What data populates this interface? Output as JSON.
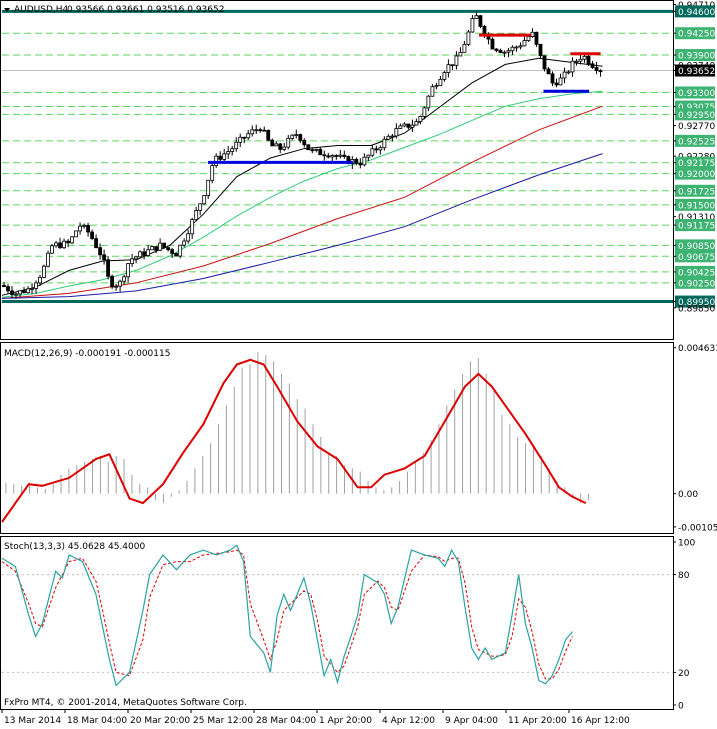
{
  "header": {
    "symbol": "AUDUSD,H4",
    "ohlc": "0.93566 0.93661 0.93516 0.93652"
  },
  "footer": {
    "copyright": "FxPro MT4, © 2001-2014, MetaQuotes Software Corp."
  },
  "colors": {
    "candles": "#000000",
    "level_major": "#00695c",
    "level_minor": "#5cd65c",
    "ma_fast": "#000000",
    "ma_medium": "#32cd7a",
    "ma_slow": "#cc1111",
    "ma_long": "#1a1aa8",
    "support": "#0000dd",
    "resistance": "#dd0000",
    "macd_signal": "#dd0000",
    "macd_hist": "#a0a0a0",
    "stoch_main": "#2aa3a3",
    "stoch_signal": "#dd0000",
    "price_tag_bg": "#000000",
    "level_tag_bg": "#3cb371",
    "major_tag_bg": "#00695c"
  },
  "chart_data": [
    {
      "type": "candlestick",
      "panel": "price",
      "ylim": [
        0.8935,
        0.9475
      ],
      "x_tick_labels": [
        "13 Mar 2014",
        "18 Mar 04:00",
        "20 Mar 20:00",
        "25 Mar 12:00",
        "28 Mar 04:00",
        "1 Apr 20:00",
        "4 Apr 12:00",
        "9 Apr 04:00",
        "11 Apr 20:00",
        "16 Apr 12:00"
      ],
      "y_tick_labels": [
        "0.94710",
        "0.94600",
        "0.94250",
        "0.93900",
        "0.93740",
        "0.93652",
        "0.93300",
        "0.93075",
        "0.92950",
        "0.92770",
        "0.92525",
        "0.92280",
        "0.92175",
        "0.92000",
        "0.91725",
        "0.91500",
        "0.91310",
        "0.91175",
        "0.90850",
        "0.90675",
        "0.90425",
        "0.90250",
        "0.89950",
        "0.89850"
      ],
      "current_price": 0.93652,
      "major_levels": [
        0.946,
        0.8995
      ],
      "minor_levels": [
        0.9425,
        0.939,
        0.933,
        0.93075,
        0.9295,
        0.92525,
        0.92175,
        0.92,
        0.91725,
        0.915,
        0.91175,
        0.9085,
        0.90675,
        0.90425,
        0.9025
      ],
      "support_lines": [
        {
          "x_from": 0.307,
          "x_to": 0.523,
          "price": 0.9218
        },
        {
          "x_from": 0.807,
          "x_to": 0.875,
          "price": 0.9332
        }
      ],
      "resistance_lines": [
        {
          "x_from": 0.711,
          "x_to": 0.788,
          "price": 0.9422
        },
        {
          "x_from": 0.847,
          "x_to": 0.892,
          "price": 0.9392
        }
      ],
      "price_path": [
        [
          0.0,
          0.9021
        ],
        [
          0.02,
          0.9008
        ],
        [
          0.04,
          0.9015
        ],
        [
          0.06,
          0.9042
        ],
        [
          0.075,
          0.9085
        ],
        [
          0.1,
          0.9088
        ],
        [
          0.115,
          0.9118
        ],
        [
          0.13,
          0.9105
        ],
        [
          0.15,
          0.9065
        ],
        [
          0.16,
          0.9025
        ],
        [
          0.175,
          0.9022
        ],
        [
          0.19,
          0.9062
        ],
        [
          0.21,
          0.9072
        ],
        [
          0.235,
          0.9085
        ],
        [
          0.26,
          0.9072
        ],
        [
          0.28,
          0.9115
        ],
        [
          0.3,
          0.9165
        ],
        [
          0.315,
          0.922
        ],
        [
          0.34,
          0.9238
        ],
        [
          0.365,
          0.9262
        ],
        [
          0.385,
          0.9275
        ],
        [
          0.4,
          0.9245
        ],
        [
          0.415,
          0.924
        ],
        [
          0.44,
          0.9265
        ],
        [
          0.46,
          0.9235
        ],
        [
          0.49,
          0.9232
        ],
        [
          0.51,
          0.9222
        ],
        [
          0.535,
          0.9218
        ],
        [
          0.56,
          0.9242
        ],
        [
          0.585,
          0.9268
        ],
        [
          0.6,
          0.9275
        ],
        [
          0.62,
          0.9283
        ],
        [
          0.64,
          0.9335
        ],
        [
          0.66,
          0.9368
        ],
        [
          0.68,
          0.9385
        ],
        [
          0.695,
          0.9425
        ],
        [
          0.705,
          0.9455
        ],
        [
          0.715,
          0.9435
        ],
        [
          0.73,
          0.9405
        ],
        [
          0.75,
          0.9395
        ],
        [
          0.77,
          0.9405
        ],
        [
          0.79,
          0.9425
        ],
        [
          0.805,
          0.9378
        ],
        [
          0.82,
          0.9345
        ],
        [
          0.835,
          0.9352
        ],
        [
          0.85,
          0.9375
        ],
        [
          0.865,
          0.939
        ],
        [
          0.88,
          0.9375
        ],
        [
          0.895,
          0.9365
        ]
      ],
      "moving_averages": [
        {
          "name": "ma_fast",
          "points": [
            [
              0.0,
              0.9005
            ],
            [
              0.05,
              0.9018
            ],
            [
              0.1,
              0.9045
            ],
            [
              0.15,
              0.906
            ],
            [
              0.2,
              0.9062
            ],
            [
              0.25,
              0.9085
            ],
            [
              0.3,
              0.9135
            ],
            [
              0.35,
              0.9195
            ],
            [
              0.4,
              0.9225
            ],
            [
              0.45,
              0.924
            ],
            [
              0.5,
              0.9245
            ],
            [
              0.55,
              0.9245
            ],
            [
              0.6,
              0.9265
            ],
            [
              0.65,
              0.9305
            ],
            [
              0.7,
              0.9345
            ],
            [
              0.75,
              0.9375
            ],
            [
              0.8,
              0.9385
            ],
            [
              0.85,
              0.9378
            ],
            [
              0.895,
              0.9372
            ]
          ]
        },
        {
          "name": "ma_medium",
          "points": [
            [
              0.0,
              0.9002
            ],
            [
              0.05,
              0.9008
            ],
            [
              0.1,
              0.902
            ],
            [
              0.15,
              0.903
            ],
            [
              0.2,
              0.9045
            ],
            [
              0.25,
              0.9068
            ],
            [
              0.3,
              0.9098
            ],
            [
              0.35,
              0.9132
            ],
            [
              0.4,
              0.9162
            ],
            [
              0.45,
              0.9188
            ],
            [
              0.5,
              0.9208
            ],
            [
              0.55,
              0.9222
            ],
            [
              0.6,
              0.9242
            ],
            [
              0.65,
              0.9262
            ],
            [
              0.7,
              0.9285
            ],
            [
              0.75,
              0.9308
            ],
            [
              0.8,
              0.932
            ],
            [
              0.85,
              0.9328
            ],
            [
              0.895,
              0.9332
            ]
          ]
        },
        {
          "name": "ma_slow",
          "points": [
            [
              0.0,
              0.9
            ],
            [
              0.1,
              0.9008
            ],
            [
              0.2,
              0.9025
            ],
            [
              0.3,
              0.9052
            ],
            [
              0.4,
              0.9088
            ],
            [
              0.5,
              0.9128
            ],
            [
              0.6,
              0.9162
            ],
            [
              0.7,
              0.9218
            ],
            [
              0.8,
              0.927
            ],
            [
              0.895,
              0.9308
            ]
          ]
        },
        {
          "name": "ma_long",
          "points": [
            [
              0.0,
              0.9
            ],
            [
              0.1,
              0.9003
            ],
            [
              0.2,
              0.9012
            ],
            [
              0.3,
              0.9032
            ],
            [
              0.4,
              0.9058
            ],
            [
              0.5,
              0.9085
            ],
            [
              0.6,
              0.9115
            ],
            [
              0.7,
              0.9158
            ],
            [
              0.8,
              0.9198
            ],
            [
              0.895,
              0.9232
            ]
          ]
        }
      ]
    },
    {
      "type": "macd",
      "panel": "macd",
      "title": "MACD(12,26,9) -0.000191 -0.000115",
      "ylim": [
        -0.00125,
        0.00475
      ],
      "y_tick_labels": [
        "0.004631",
        "0.00",
        "-0.001056"
      ],
      "signal": [
        [
          0.0,
          -0.0009
        ],
        [
          0.02,
          -0.0003
        ],
        [
          0.04,
          0.0003
        ],
        [
          0.06,
          0.00025
        ],
        [
          0.1,
          0.0005
        ],
        [
          0.14,
          0.0011
        ],
        [
          0.16,
          0.00125
        ],
        [
          0.19,
          -0.00015
        ],
        [
          0.21,
          -0.0003
        ],
        [
          0.24,
          0.0003
        ],
        [
          0.27,
          0.0013
        ],
        [
          0.3,
          0.0022
        ],
        [
          0.33,
          0.0035
        ],
        [
          0.35,
          0.0041
        ],
        [
          0.37,
          0.00425
        ],
        [
          0.39,
          0.0041
        ],
        [
          0.41,
          0.0034
        ],
        [
          0.44,
          0.0023
        ],
        [
          0.47,
          0.0015
        ],
        [
          0.5,
          0.0011
        ],
        [
          0.53,
          0.0002
        ],
        [
          0.55,
          0.0002
        ],
        [
          0.57,
          0.0006
        ],
        [
          0.6,
          0.0008
        ],
        [
          0.63,
          0.0012
        ],
        [
          0.66,
          0.0023
        ],
        [
          0.69,
          0.0034
        ],
        [
          0.71,
          0.0038
        ],
        [
          0.73,
          0.0034
        ],
        [
          0.76,
          0.0025
        ],
        [
          0.78,
          0.0019
        ],
        [
          0.81,
          0.0009
        ],
        [
          0.83,
          0.0002
        ],
        [
          0.85,
          -0.0001
        ],
        [
          0.87,
          -0.0003
        ]
      ],
      "histogram": [
        0.00035,
        0.0003,
        0.00025,
        0.00035,
        0.0002,
        0.00015,
        0.0003,
        0.0006,
        0.0008,
        0.0009,
        0.001,
        0.0011,
        0.0012,
        0.001,
        0.0012,
        0.0011,
        0.0006,
        0.0003,
        0.0002,
        -0.0002,
        -0.0003,
        -0.0001,
        0.0001,
        0.0004,
        0.0008,
        0.0012,
        0.0016,
        0.0022,
        0.0028,
        0.0034,
        0.004,
        0.0041,
        0.0045,
        0.0044,
        0.0042,
        0.0038,
        0.0035,
        0.003,
        0.0027,
        0.0022,
        0.0018,
        0.0013,
        0.0012,
        0.0009,
        0.0008,
        0.0007,
        0.0004,
        0.0002,
        0.0001,
        0.0002,
        0.0004,
        0.0007,
        0.001,
        0.0013,
        0.0017,
        0.0022,
        0.0028,
        0.0033,
        0.0038,
        0.0042,
        0.0043,
        0.0038,
        0.0033,
        0.0025,
        0.0022,
        0.0018,
        0.0016,
        0.0015,
        0.0012,
        0.0008,
        0.0004,
        0.0002,
        -0.0001,
        -0.0003,
        -0.0002
      ]
    },
    {
      "type": "stochastic",
      "panel": "stoch",
      "title": "Stoch(13,3,3) 45.0628 45.4000",
      "ylim": [
        0,
        100
      ],
      "y_tick_labels": [
        "100",
        "80",
        "20",
        "0"
      ],
      "levels": [
        80,
        20
      ],
      "main": [
        [
          0.0,
          90
        ],
        [
          0.02,
          85
        ],
        [
          0.04,
          55
        ],
        [
          0.05,
          42
        ],
        [
          0.06,
          50
        ],
        [
          0.08,
          82
        ],
        [
          0.09,
          78
        ],
        [
          0.1,
          92
        ],
        [
          0.12,
          88
        ],
        [
          0.14,
          68
        ],
        [
          0.15,
          48
        ],
        [
          0.16,
          28
        ],
        [
          0.17,
          12
        ],
        [
          0.19,
          20
        ],
        [
          0.21,
          58
        ],
        [
          0.22,
          80
        ],
        [
          0.24,
          92
        ],
        [
          0.26,
          83
        ],
        [
          0.28,
          92
        ],
        [
          0.3,
          95
        ],
        [
          0.32,
          92
        ],
        [
          0.34,
          95
        ],
        [
          0.35,
          98
        ],
        [
          0.36,
          88
        ],
        [
          0.37,
          42
        ],
        [
          0.39,
          32
        ],
        [
          0.4,
          20
        ],
        [
          0.41,
          55
        ],
        [
          0.42,
          68
        ],
        [
          0.43,
          58
        ],
        [
          0.45,
          78
        ],
        [
          0.46,
          62
        ],
        [
          0.47,
          40
        ],
        [
          0.48,
          18
        ],
        [
          0.49,
          28
        ],
        [
          0.5,
          14
        ],
        [
          0.51,
          30
        ],
        [
          0.52,
          42
        ],
        [
          0.53,
          55
        ],
        [
          0.54,
          80
        ],
        [
          0.56,
          75
        ],
        [
          0.57,
          68
        ],
        [
          0.58,
          50
        ],
        [
          0.59,
          60
        ],
        [
          0.61,
          95
        ],
        [
          0.63,
          92
        ],
        [
          0.65,
          90
        ],
        [
          0.66,
          85
        ],
        [
          0.67,
          95
        ],
        [
          0.68,
          88
        ],
        [
          0.69,
          60
        ],
        [
          0.7,
          35
        ],
        [
          0.71,
          28
        ],
        [
          0.72,
          35
        ],
        [
          0.73,
          28
        ],
        [
          0.74,
          30
        ],
        [
          0.75,
          32
        ],
        [
          0.76,
          55
        ],
        [
          0.77,
          80
        ],
        [
          0.78,
          50
        ],
        [
          0.79,
          35
        ],
        [
          0.8,
          15
        ],
        [
          0.81,
          13
        ],
        [
          0.82,
          18
        ],
        [
          0.83,
          28
        ],
        [
          0.84,
          40
        ],
        [
          0.85,
          45
        ]
      ],
      "signal": [
        [
          0.0,
          88
        ],
        [
          0.02,
          82
        ],
        [
          0.04,
          62
        ],
        [
          0.05,
          50
        ],
        [
          0.06,
          48
        ],
        [
          0.08,
          72
        ],
        [
          0.09,
          80
        ],
        [
          0.1,
          88
        ],
        [
          0.12,
          90
        ],
        [
          0.14,
          76
        ],
        [
          0.15,
          58
        ],
        [
          0.16,
          38
        ],
        [
          0.17,
          20
        ],
        [
          0.19,
          18
        ],
        [
          0.21,
          40
        ],
        [
          0.22,
          66
        ],
        [
          0.24,
          86
        ],
        [
          0.26,
          88
        ],
        [
          0.28,
          88
        ],
        [
          0.3,
          92
        ],
        [
          0.32,
          93
        ],
        [
          0.34,
          94
        ],
        [
          0.35,
          95
        ],
        [
          0.36,
          92
        ],
        [
          0.37,
          62
        ],
        [
          0.39,
          40
        ],
        [
          0.4,
          28
        ],
        [
          0.41,
          40
        ],
        [
          0.42,
          58
        ],
        [
          0.43,
          62
        ],
        [
          0.45,
          70
        ],
        [
          0.46,
          68
        ],
        [
          0.47,
          52
        ],
        [
          0.48,
          30
        ],
        [
          0.49,
          25
        ],
        [
          0.5,
          20
        ],
        [
          0.51,
          24
        ],
        [
          0.52,
          36
        ],
        [
          0.53,
          48
        ],
        [
          0.54,
          68
        ],
        [
          0.56,
          76
        ],
        [
          0.57,
          72
        ],
        [
          0.58,
          60
        ],
        [
          0.59,
          58
        ],
        [
          0.61,
          82
        ],
        [
          0.63,
          92
        ],
        [
          0.65,
          91
        ],
        [
          0.66,
          88
        ],
        [
          0.67,
          90
        ],
        [
          0.68,
          90
        ],
        [
          0.69,
          75
        ],
        [
          0.7,
          48
        ],
        [
          0.71,
          34
        ],
        [
          0.72,
          32
        ],
        [
          0.73,
          30
        ],
        [
          0.74,
          30
        ],
        [
          0.75,
          31
        ],
        [
          0.76,
          42
        ],
        [
          0.77,
          65
        ],
        [
          0.78,
          60
        ],
        [
          0.79,
          45
        ],
        [
          0.8,
          25
        ],
        [
          0.81,
          16
        ],
        [
          0.82,
          16
        ],
        [
          0.83,
          22
        ],
        [
          0.84,
          33
        ],
        [
          0.85,
          42
        ]
      ]
    }
  ]
}
